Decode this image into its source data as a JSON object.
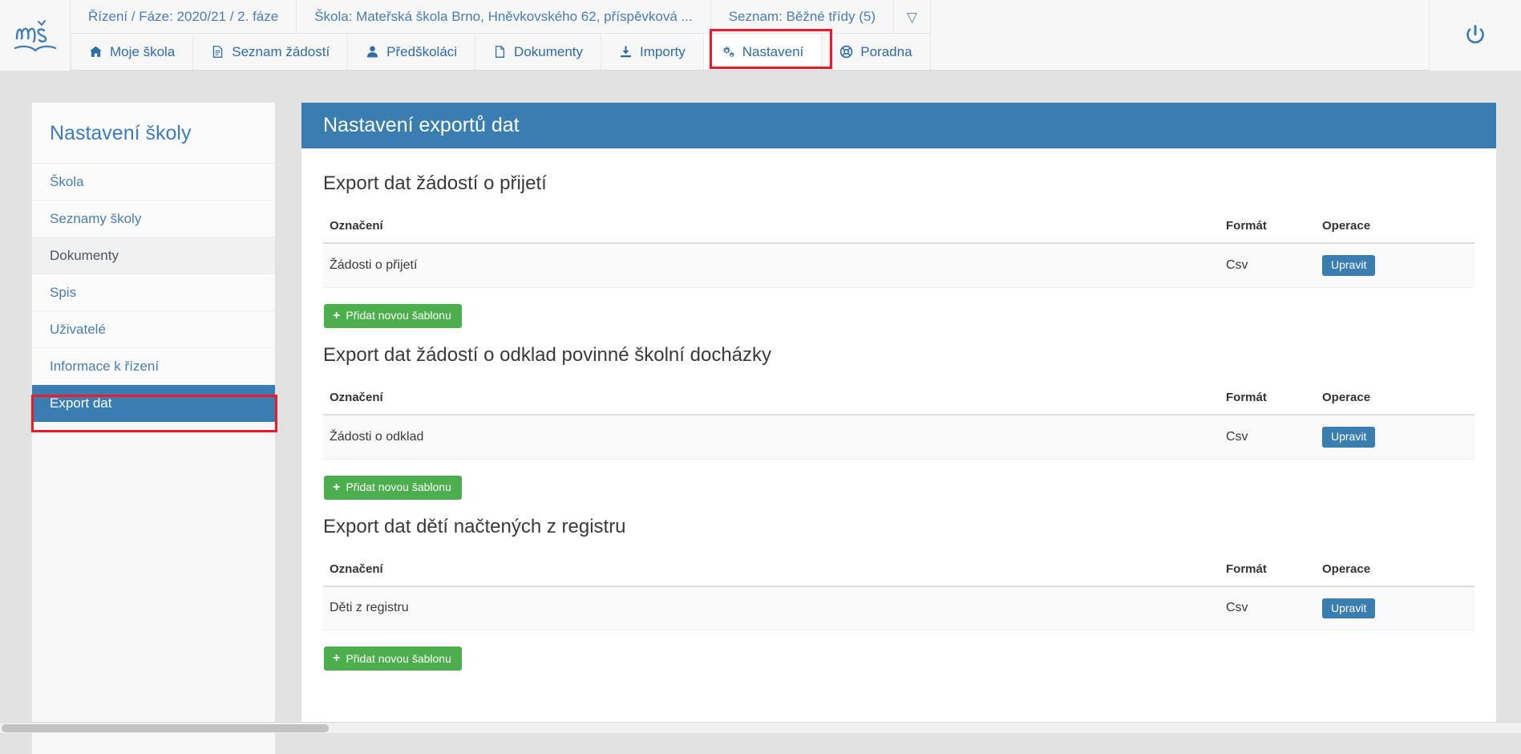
{
  "app": {
    "logo_alt": "mš",
    "logo_color": "#3f7cb8",
    "accent_blue": "#3a7db1",
    "accent_green": "#4cae4c",
    "highlight_red": "#f0192a"
  },
  "header": {
    "context_items": [
      {
        "label": "Řízení / Fáze: 2020/21 / 2. fáze",
        "name": "context-rizeni-faze"
      },
      {
        "label": "Škola: Mateřská škola Brno, Hněvkovského 62, příspěvková ...",
        "name": "context-skola"
      },
      {
        "label": "Seznam: Běžné třídy (5)",
        "name": "context-seznam"
      }
    ],
    "caret_glyph": "▽",
    "nav_items": [
      {
        "label": "Moje škola",
        "icon": "home-icon",
        "name": "nav-moje-skola",
        "active": false
      },
      {
        "label": "Seznam žádostí",
        "icon": "document-icon",
        "name": "nav-seznam-zadosti",
        "active": false
      },
      {
        "label": "Předškoláci",
        "icon": "user-icon",
        "name": "nav-predskolaci",
        "active": false
      },
      {
        "label": "Dokumenty",
        "icon": "file-icon",
        "name": "nav-dokumenty",
        "active": false
      },
      {
        "label": "Importy",
        "icon": "download-icon",
        "name": "nav-importy",
        "active": false
      },
      {
        "label": "Nastavení",
        "icon": "gears-icon",
        "name": "nav-nastaveni",
        "active": true
      },
      {
        "label": "Poradna",
        "icon": "lifebuoy-icon",
        "name": "nav-poradna",
        "active": false
      }
    ],
    "power_icon": "power-icon"
  },
  "sidebar": {
    "title": "Nastavení školy",
    "items": [
      {
        "label": "Škola",
        "name": "sidebar-item-skola",
        "style": "plain",
        "selected": false
      },
      {
        "label": "Seznamy školy",
        "name": "sidebar-item-seznamy",
        "style": "plain",
        "selected": false
      },
      {
        "label": "Dokumenty",
        "name": "sidebar-item-dokumenty",
        "style": "alt",
        "selected": false
      },
      {
        "label": "Spis",
        "name": "sidebar-item-spis",
        "style": "plain",
        "selected": false
      },
      {
        "label": "Uživatelé",
        "name": "sidebar-item-uzivatele",
        "style": "plain",
        "selected": false
      },
      {
        "label": "Informace k řízení",
        "name": "sidebar-item-informace",
        "style": "plain",
        "selected": false
      },
      {
        "label": "Export dat",
        "name": "sidebar-item-export-dat",
        "style": "plain",
        "selected": true
      }
    ]
  },
  "main": {
    "title": "Nastavení exportů dat",
    "columns": {
      "oznaceni": "Označení",
      "format": "Formát",
      "operace": "Operace"
    },
    "add_button_label": "Přidat novou šablonu",
    "edit_button_label": "Upravit",
    "sections": [
      {
        "title": "Export dat žádostí o přijetí",
        "name": "section-export-zadosti-prijeti",
        "rows": [
          {
            "oznaceni": "Žádosti o přijetí",
            "format": "Csv"
          }
        ]
      },
      {
        "title": "Export dat žádostí o odklad povinné školní docházky",
        "name": "section-export-zadosti-odklad",
        "rows": [
          {
            "oznaceni": "Žádosti o odklad",
            "format": "Csv"
          }
        ]
      },
      {
        "title": "Export dat dětí načtených z registru",
        "name": "section-export-deti-registr",
        "rows": [
          {
            "oznaceni": "Děti z registru",
            "format": "Csv"
          }
        ]
      }
    ]
  }
}
